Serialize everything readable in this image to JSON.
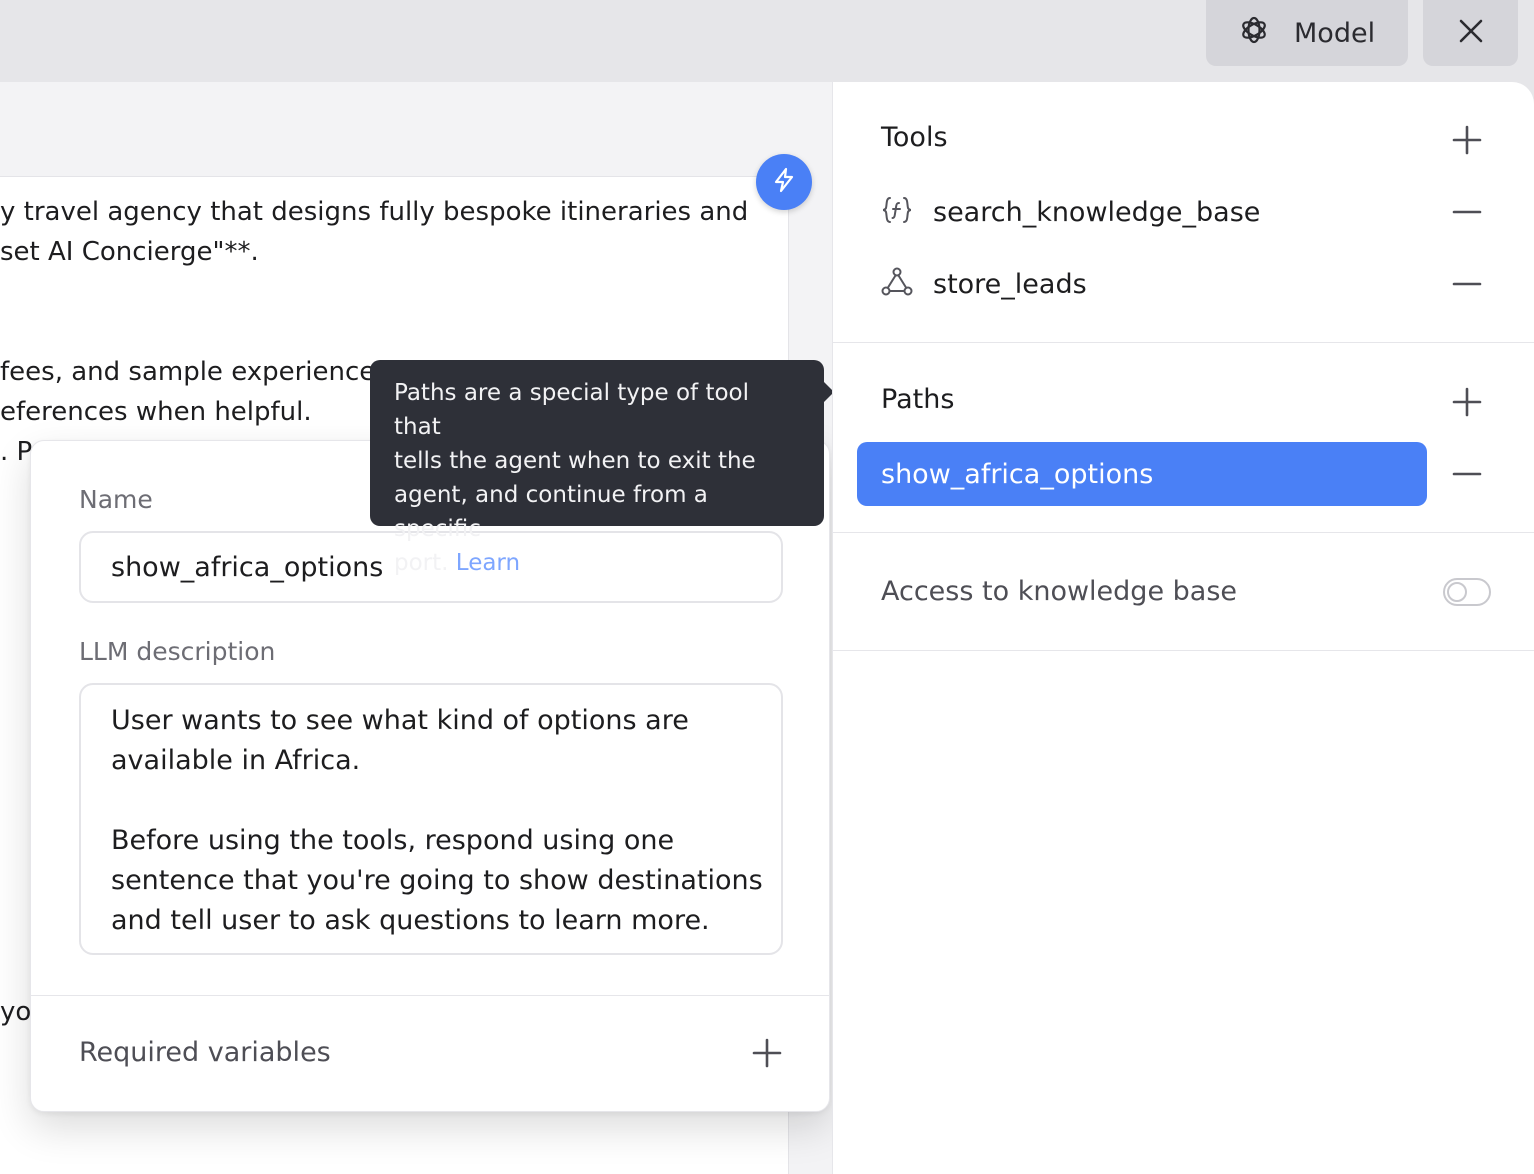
{
  "header": {
    "model_label": "Model",
    "model_icon": "openai-icon",
    "close_icon": "close-icon"
  },
  "editor": {
    "lines": [
      "y travel agency that designs fully bespoke itineraries and",
      "set AI Concierge\"**.",
      "fees, and sample experience",
      "eferences when helpful.",
      ". Po",
      " yo"
    ],
    "action_icon": "lightning-icon"
  },
  "path_editor": {
    "name_label": "Name",
    "name_value": "show_africa_options",
    "description_label": "LLM description",
    "description_lines": [
      "User wants to see what kind of options are",
      "available in Africa.",
      "Before using the tools, respond using one",
      "sentence that you're going to show destinations",
      "and tell user to ask questions to learn more."
    ],
    "required_variables_label": "Required variables"
  },
  "tooltip": {
    "text": "Paths are a special type of tool that tells the agent when to exit the agent, and continue from a specific port.",
    "lines": [
      "Paths are a special type of tool that",
      "tells the agent when to exit the",
      "agent, and continue from a specific",
      "port."
    ],
    "link_label": "Learn"
  },
  "sidebar": {
    "tools_title": "Tools",
    "tools": [
      {
        "name": "search_knowledge_base",
        "icon": "function-icon"
      },
      {
        "name": "store_leads",
        "icon": "integration-icon"
      }
    ],
    "paths_title": "Paths",
    "paths": [
      {
        "name": "show_africa_options",
        "selected": true
      }
    ],
    "knowledge_base_label": "Access to knowledge base",
    "knowledge_base_enabled": false
  },
  "colors": {
    "accent": "#4a80f6",
    "tooltip_bg": "#2e3038",
    "link": "#7ea6ff"
  }
}
